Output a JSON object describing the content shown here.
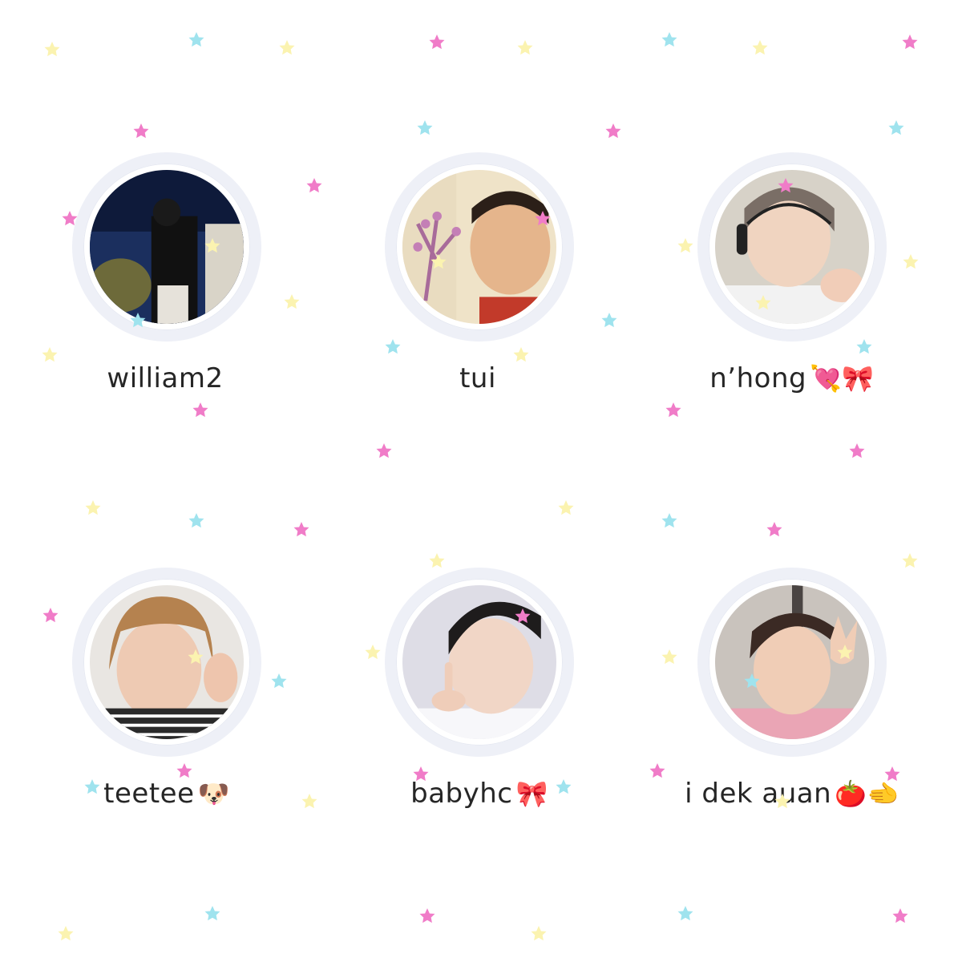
{
  "profiles": [
    {
      "name": "william2",
      "emoji": ""
    },
    {
      "name": "tui",
      "emoji": ""
    },
    {
      "name": "n’hong",
      "emoji": "💘🎀"
    },
    {
      "name": "teetee",
      "emoji": "🐶"
    },
    {
      "name": "babyhc",
      "emoji": "🎀"
    },
    {
      "name": "i dek auan",
      "emoji": "🍅🫲"
    }
  ],
  "colors": {
    "star_pink": "#f07cc8",
    "star_blue": "#9fe3ee",
    "star_yellow": "#fbf3b0",
    "ring": "#eef0f7"
  }
}
